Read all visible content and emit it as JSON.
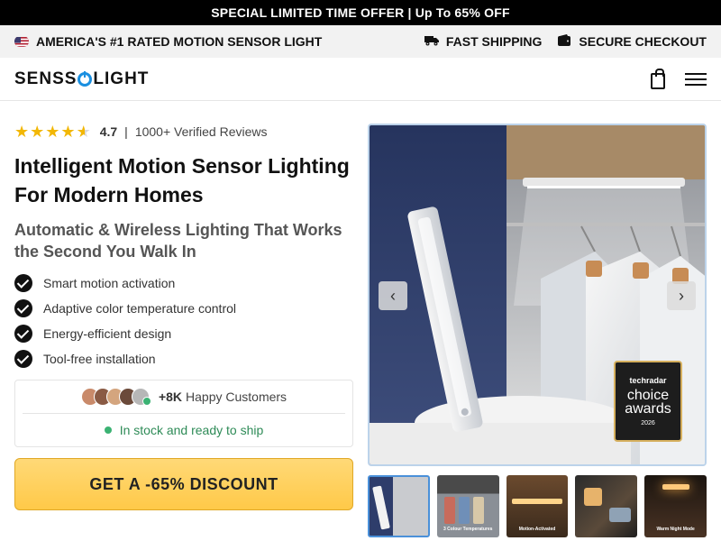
{
  "promo": {
    "text": "SPECIAL LIMITED TIME OFFER | Up To 65% OFF"
  },
  "trust": {
    "left": {
      "icon": "us-flag-icon",
      "text": "AMERICA'S #1 RATED MOTION SENSOR LIGHT"
    },
    "right": [
      {
        "icon": "truck-icon",
        "text": "FAST SHIPPING"
      },
      {
        "icon": "wallet-icon",
        "text": "SECURE CHECKOUT"
      }
    ]
  },
  "header": {
    "logo_left": "SENSS",
    "logo_right": "LIGHT",
    "icons": [
      "shopping-bag-icon",
      "hamburger-menu-icon"
    ]
  },
  "rating": {
    "stars": 4.5,
    "value": "4.7",
    "separator": "|",
    "reviews": "1000+ Verified Reviews"
  },
  "product": {
    "headline": "Intelligent Motion Sensor Lighting For Modern Homes",
    "subhead": "Automatic & Wireless Lighting That Works the Second You Walk In",
    "features": [
      "Smart motion activation",
      "Adaptive color temperature control",
      "Energy-efficient design",
      "Tool-free installation"
    ]
  },
  "social": {
    "count": "+8K",
    "label": "Happy Customers",
    "stock": "In stock and ready to ship"
  },
  "cta": {
    "label": "GET A -65% DISCOUNT"
  },
  "gallery": {
    "award": {
      "brand": "techradar",
      "line1": "choice",
      "line2": "awards",
      "year": "2026"
    },
    "thumbs": [
      {
        "caption": ""
      },
      {
        "caption": "3 Colour Temperatures"
      },
      {
        "caption": "Motion-Activated"
      },
      {
        "caption": ""
      },
      {
        "caption": "Warm Night Mode"
      }
    ]
  },
  "colors": {
    "accent": "#1a8fe0",
    "cta": "#ffc948",
    "stock": "#2e8b57",
    "star": "#f2b705"
  }
}
